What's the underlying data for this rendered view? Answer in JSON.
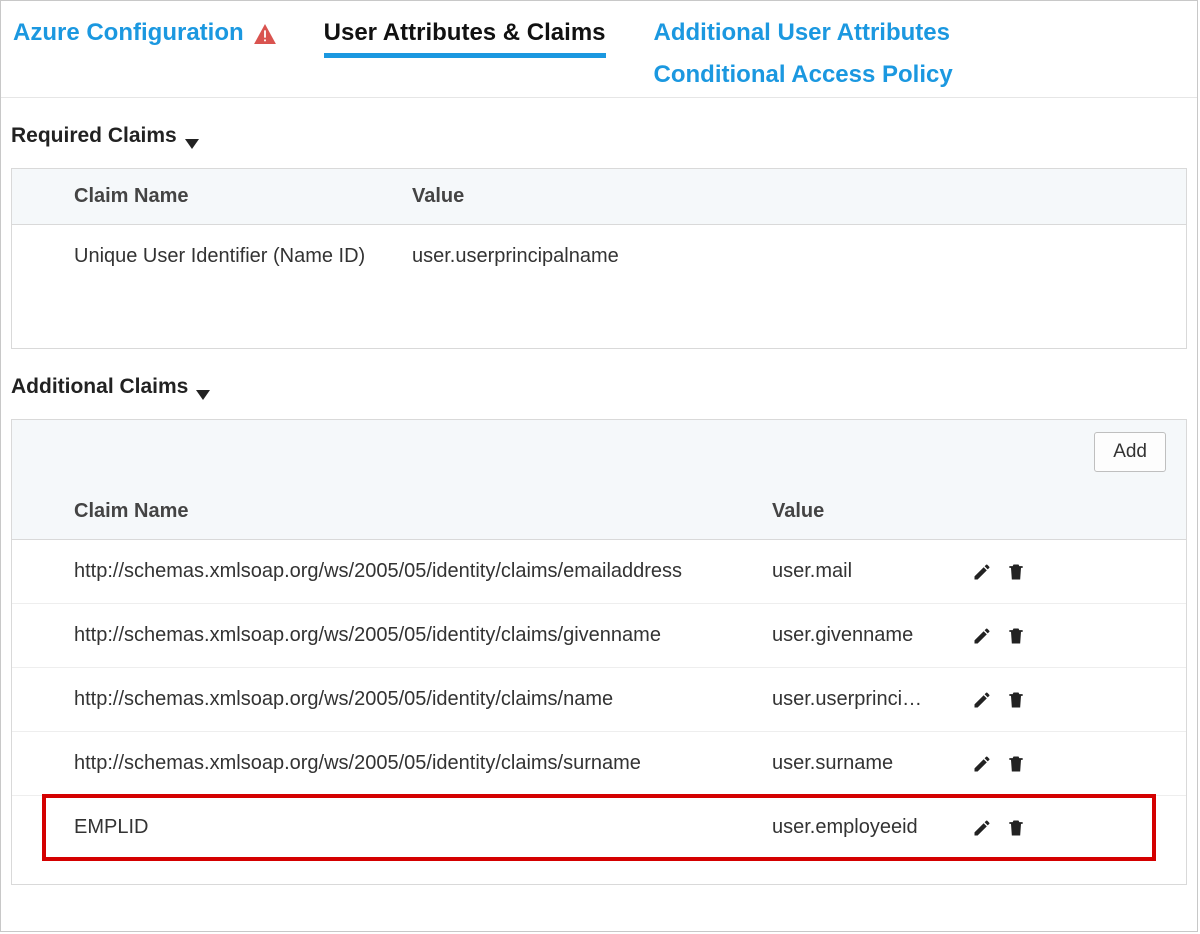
{
  "tabs": {
    "azure_config": "Azure Configuration",
    "user_attrs": "User Attributes & Claims",
    "additional_attrs": "Additional User Attributes",
    "conditional_policy": "Conditional Access Policy"
  },
  "sections": {
    "required": {
      "title": "Required Claims",
      "columns": {
        "name": "Claim Name",
        "value": "Value"
      },
      "rows": [
        {
          "name": "Unique User Identifier (Name ID)",
          "value": "user.userprincipalname"
        }
      ]
    },
    "additional": {
      "title": "Additional Claims",
      "add_button": "Add",
      "columns": {
        "name": "Claim Name",
        "value": "Value"
      },
      "rows": [
        {
          "name": "http://schemas.xmlsoap.org/ws/2005/05/identity/claims/emailaddress",
          "value": "user.mail"
        },
        {
          "name": "http://schemas.xmlsoap.org/ws/2005/05/identity/claims/givenname",
          "value": "user.givenname"
        },
        {
          "name": "http://schemas.xmlsoap.org/ws/2005/05/identity/claims/name",
          "value": "user.userprinci…"
        },
        {
          "name": "http://schemas.xmlsoap.org/ws/2005/05/identity/claims/surname",
          "value": "user.surname"
        },
        {
          "name": "EMPLID",
          "value": "user.employeeid"
        }
      ]
    }
  }
}
